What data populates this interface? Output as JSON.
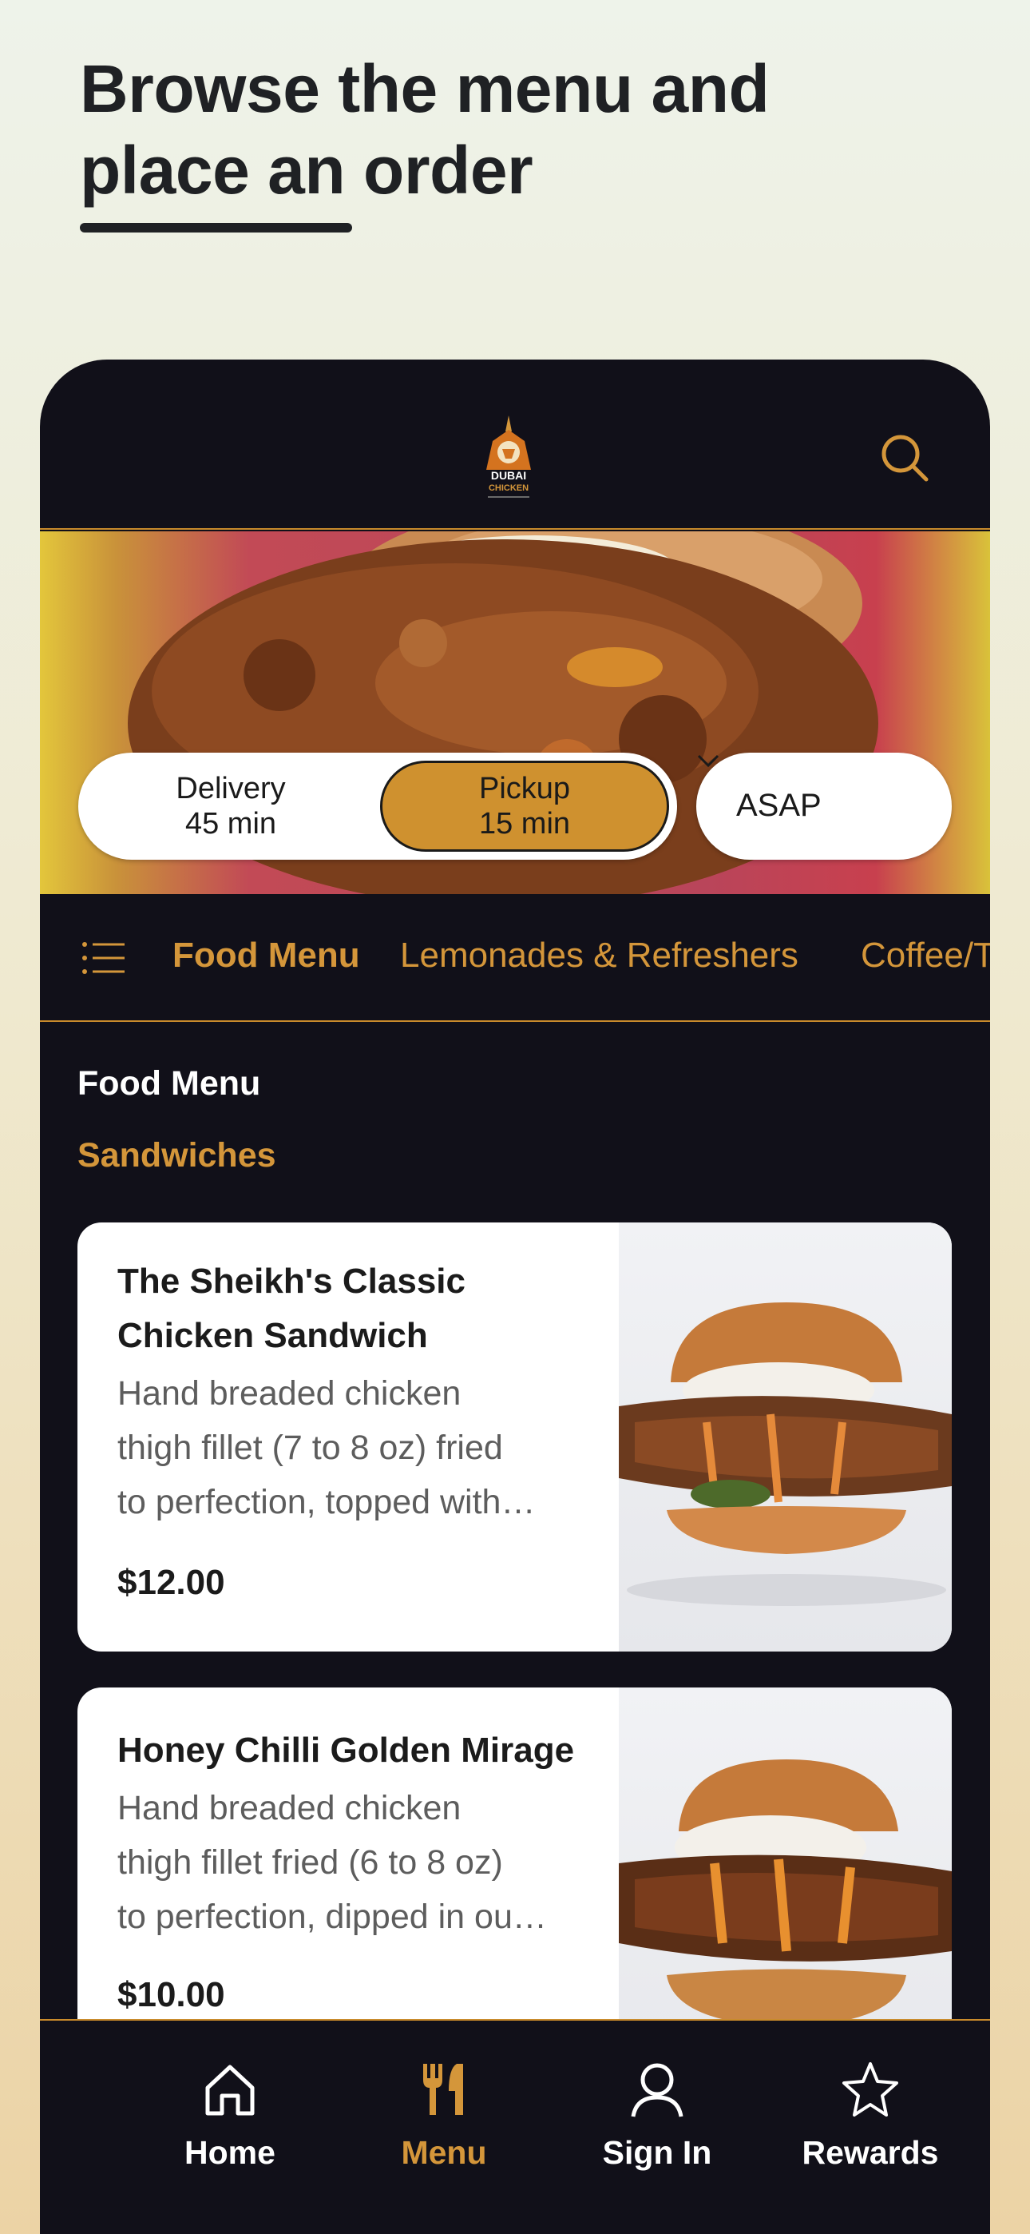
{
  "headline": {
    "line1": "Browse the menu and",
    "line2": "place an order"
  },
  "header": {
    "logo_name": "dubai-chicken-logo",
    "logo_text_1": "DUBAI",
    "logo_text_2": "CHICKEN"
  },
  "order_mode": {
    "delivery": {
      "label": "Delivery",
      "time": "45 min"
    },
    "pickup": {
      "label": "Pickup",
      "time": "15 min",
      "selected": true
    },
    "schedule": {
      "value": "ASAP"
    }
  },
  "categories": [
    "Food Menu",
    "Lemonades & Refreshers",
    "Coffee/Tea"
  ],
  "active_category": "Food Menu",
  "section": {
    "title": "Food Menu",
    "subtitle": "Sandwiches"
  },
  "items": [
    {
      "name_line1": "The Sheikh's Classic",
      "name_line2": "Chicken Sandwich",
      "desc_line1": "Hand breaded chicken",
      "desc_line2": "thigh fillet (7 to 8 oz) fried",
      "desc_line3": "to perfection, topped with…",
      "price": "$12.00"
    },
    {
      "name_line1": "Honey Chilli Golden Mirage",
      "desc_line1": "Hand breaded chicken",
      "desc_line2": "thigh fillet fried (6 to 8 oz)",
      "desc_line3": "to perfection, dipped in ou…",
      "price": "$10.00"
    }
  ],
  "bottom_nav": {
    "home": "Home",
    "menu": "Menu",
    "sign_in": "Sign In",
    "rewards": "Rewards",
    "active": "Menu"
  },
  "colors": {
    "accent": "#d4963a",
    "background": "#111019",
    "pickup_pill": "#cf912f"
  }
}
